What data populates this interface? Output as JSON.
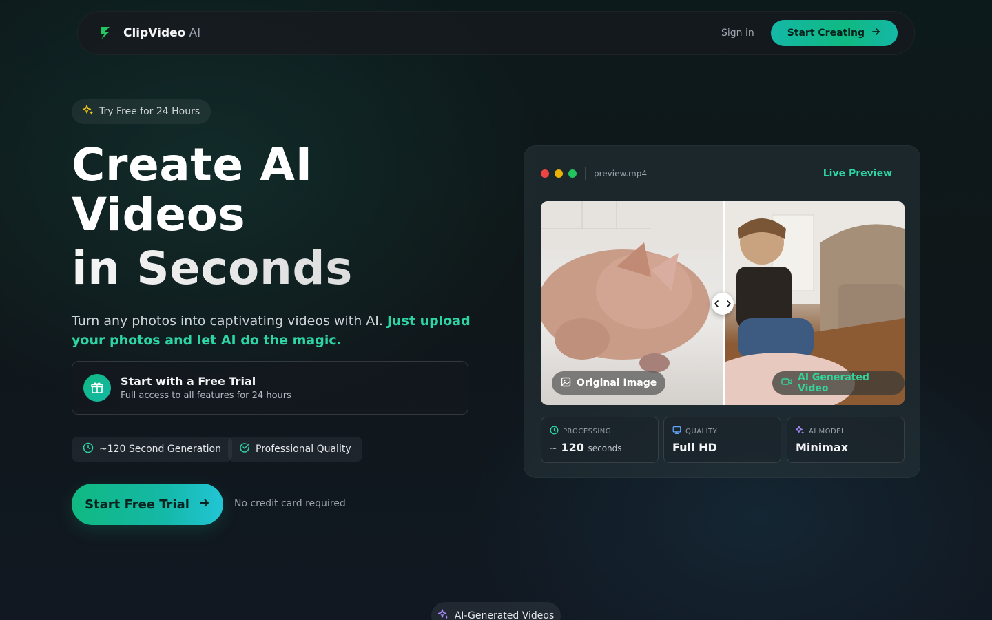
{
  "nav": {
    "brand_name": "ClipVideo",
    "brand_suffix": "AI",
    "signin": "Sign in",
    "cta": "Start Creating"
  },
  "hero": {
    "badge": "Try Free for 24 Hours",
    "headline": [
      "Create AI",
      "Videos",
      "in Seconds"
    ],
    "subtext_plain": "Turn any photos into captivating videos with AI. ",
    "subtext_highlight": "Just upload your photos and let AI do the magic.",
    "trial_title": "Start with a Free Trial",
    "trial_sub": "Full access to all features for 24 hours",
    "chips": [
      "~120 Second Generation",
      "Professional Quality"
    ],
    "cta": "Start Free Trial",
    "no_cc": "No credit card required"
  },
  "preview": {
    "filename": "preview.mp4",
    "live": "Live Preview",
    "tag_original": "Original Image",
    "tag_ai": "AI Generated Video",
    "stats": [
      {
        "label": "PROCESSING",
        "prefix": "~",
        "value": "120",
        "unit": "seconds"
      },
      {
        "label": "QUALITY",
        "value": "Full HD"
      },
      {
        "label": "AI MODEL",
        "value": "Minimax"
      }
    ]
  },
  "section_badge": "AI-Generated Videos",
  "colors": {
    "accent": "#10b981",
    "accent_text": "#2dd4a4",
    "dot_red": "#ef4444",
    "dot_yellow": "#eab308",
    "dot_green": "#22c55e"
  }
}
